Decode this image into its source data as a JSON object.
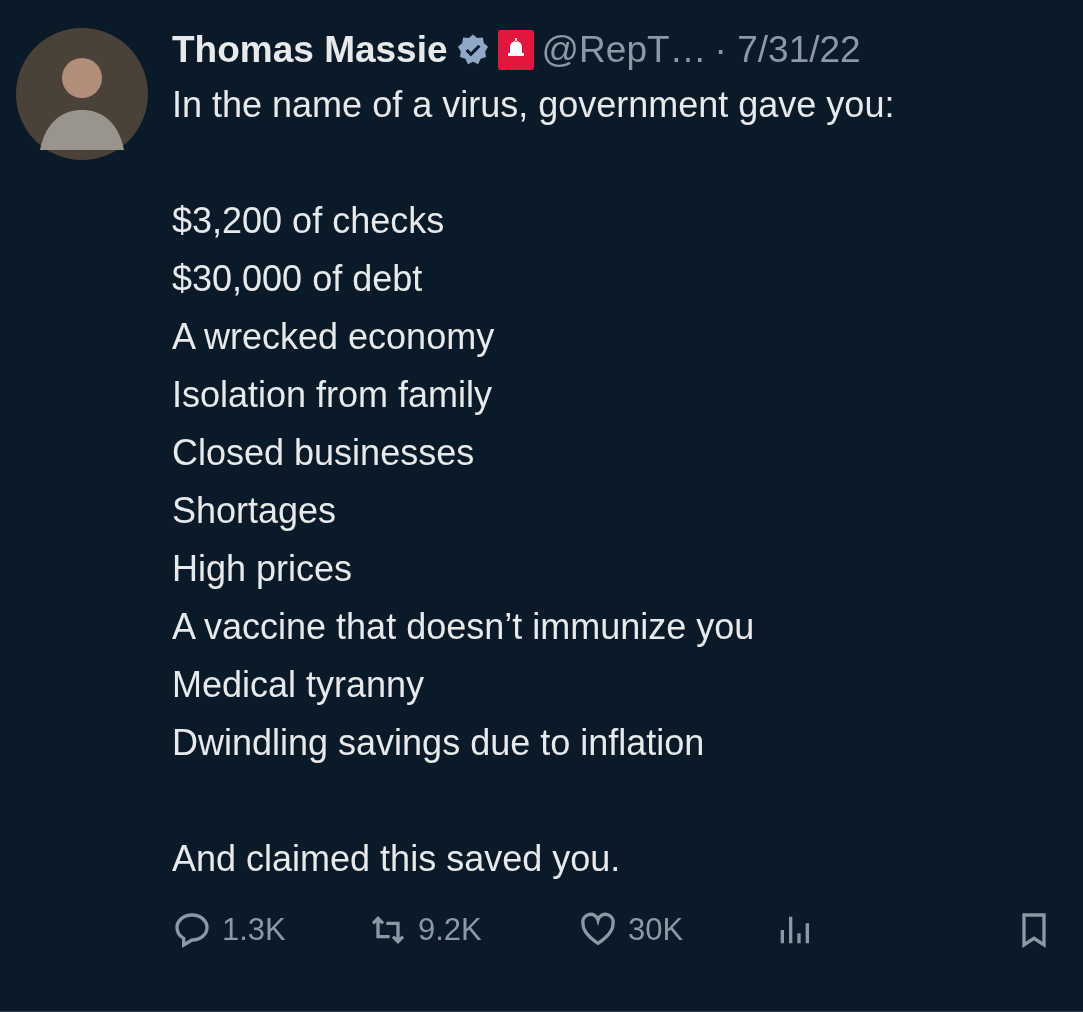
{
  "tweet": {
    "author": {
      "name": "Thomas Massie",
      "verified": true,
      "handle": "@RepT…",
      "date": "· 7/31/22"
    },
    "paragraphs": [
      {
        "lines": [
          "In the name of a virus, government gave you:"
        ]
      },
      {
        "lines": [
          "$3,200 of checks",
          "$30,000 of debt",
          "A wrecked economy",
          "Isolation from family",
          "Closed businesses",
          "Shortages",
          "High prices",
          "A vaccine that doesn’t immunize you",
          "Medical tyranny",
          "Dwindling savings due to inflation"
        ]
      },
      {
        "lines": [
          "And claimed this saved you."
        ]
      }
    ],
    "actions": [
      {
        "kind": "reply",
        "count": "1.3K"
      },
      {
        "kind": "retweet",
        "count": "9.2K"
      },
      {
        "kind": "like",
        "count": "30K"
      },
      {
        "kind": "views"
      },
      {
        "kind": "bookmark"
      }
    ]
  }
}
